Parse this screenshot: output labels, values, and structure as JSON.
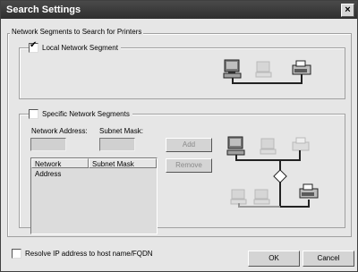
{
  "window": {
    "title": "Search Settings"
  },
  "group": {
    "title": "Network Segments to Search for Printers"
  },
  "local": {
    "label": "Local Network Segment",
    "checked": true
  },
  "specific": {
    "label": "Specific Network Segments",
    "checked": false,
    "network_address_label": "Network Address:",
    "subnet_mask_label": "Subnet Mask:",
    "network_address_value": "",
    "subnet_mask_value": "",
    "add_label": "Add",
    "remove_label": "Remove",
    "columns": [
      "Network Address",
      "Subnet Mask"
    ]
  },
  "resolve": {
    "label": "Resolve IP address to host name/FQDN",
    "checked": false
  },
  "buttons": {
    "ok": "OK",
    "cancel": "Cancel"
  },
  "icons": {
    "close": "close-icon",
    "check": "check-icon",
    "computer": "computer-icon",
    "printer": "printer-icon",
    "router": "router-icon"
  }
}
